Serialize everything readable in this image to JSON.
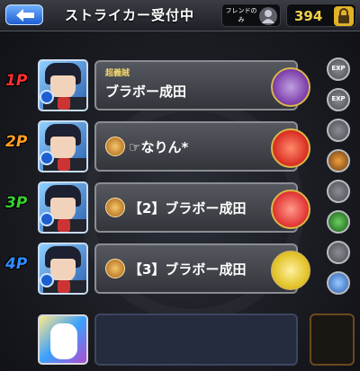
{
  "header": {
    "title": "ストライカー受付中",
    "friend_only_label": "フレンドのみ",
    "stamina_value": "394"
  },
  "rows": [
    {
      "player": "1P",
      "color": "#ff3030",
      "subtitle": "超義賊",
      "name": "ブラボー成田",
      "monster_color": "#7a3aa8",
      "side_top": "EXP",
      "side_bottom": "EXP"
    },
    {
      "player": "2P",
      "color": "#ffa020",
      "subtitle": "",
      "name": "☞なりん*",
      "monster_color": "#d82a20",
      "side_top": "",
      "side_bottom": ""
    },
    {
      "player": "3P",
      "color": "#38d030",
      "subtitle": "",
      "name": "【2】ブラボー成田",
      "monster_color": "#e03030",
      "side_top": "",
      "side_bottom": ""
    },
    {
      "player": "4P",
      "color": "#2f8cff",
      "subtitle": "",
      "name": "【3】ブラボー成田",
      "monster_color": "#e0c020",
      "side_top": "",
      "side_bottom": ""
    }
  ],
  "colors": {
    "accent_blue": "#1e5fd0",
    "stamina_gold": "#f2d04a"
  },
  "icons": {
    "back": "back-arrow-icon",
    "friend": "friend-silhouette-icon",
    "lock": "lock-icon"
  }
}
